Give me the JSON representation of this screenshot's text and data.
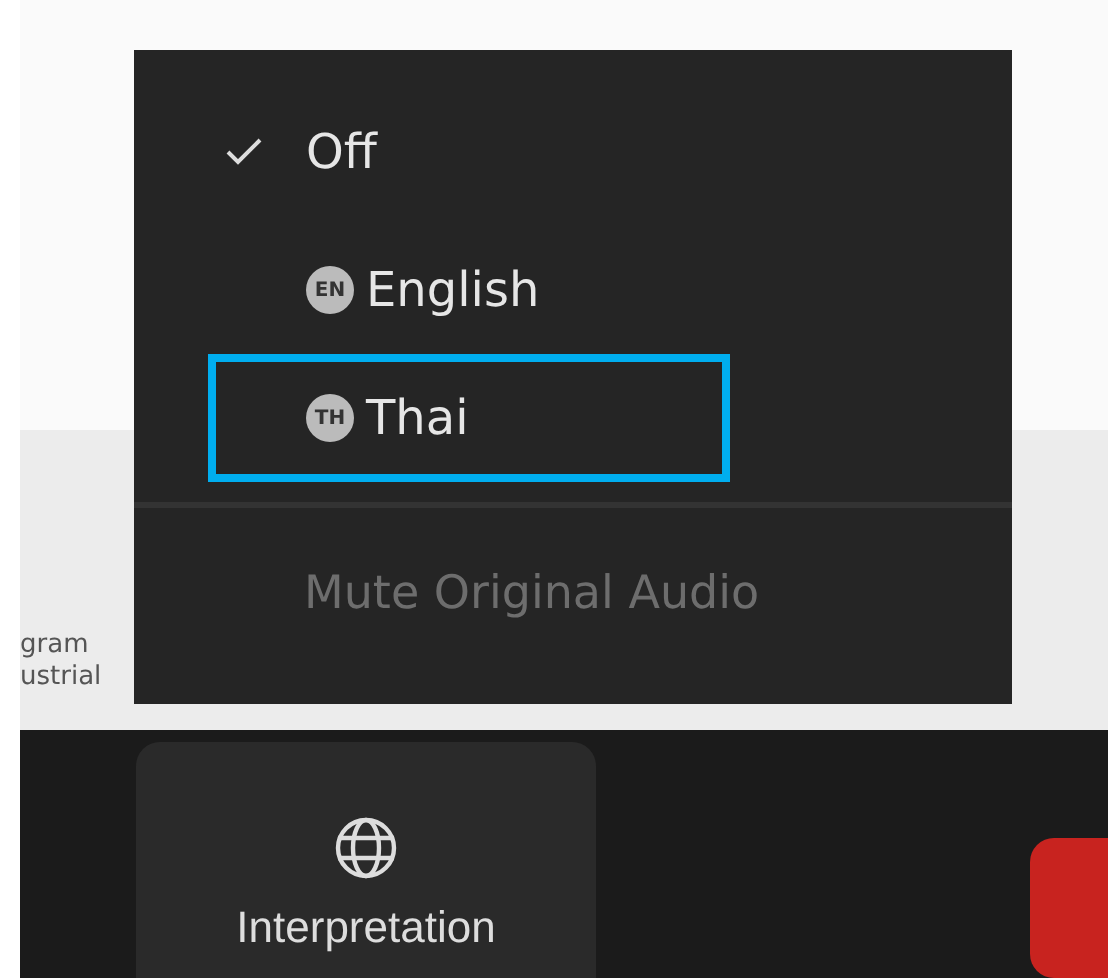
{
  "background_text": [
    "gram",
    "ustrial"
  ],
  "menu": {
    "items": [
      {
        "kind": "check",
        "label": "Off",
        "checked": true,
        "highlighted": false
      },
      {
        "kind": "language",
        "badge": "EN",
        "label": "English",
        "checked": false,
        "highlighted": false
      },
      {
        "kind": "language",
        "badge": "TH",
        "label": "Thai",
        "checked": false,
        "highlighted": true
      }
    ],
    "footer": {
      "label": "Mute Original Audio",
      "disabled": true
    }
  },
  "toolbar": {
    "label": "Interpretation"
  }
}
